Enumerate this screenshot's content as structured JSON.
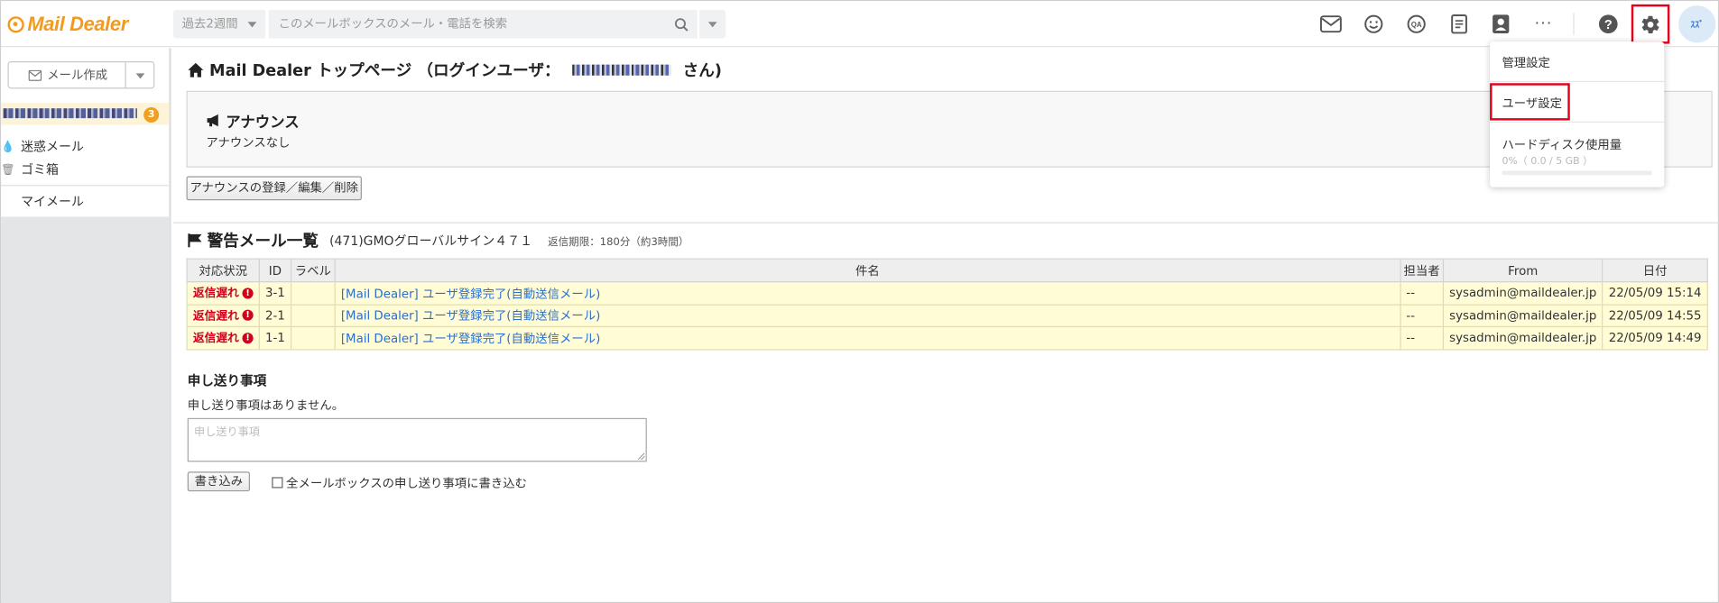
{
  "app": {
    "logo_text": "Mail Dealer",
    "brand_color": "#f39a1e",
    "accent_red": "#e2001a"
  },
  "header": {
    "period_label": "過去2週間",
    "search_placeholder": "このメールボックスのメール・電話を検索",
    "more_label": "···",
    "avatar_initials": "ｽｽﾞ",
    "icons": [
      "mail-icon",
      "smiley-icon",
      "qa-icon",
      "document-icon",
      "address-book-icon",
      "more-icon",
      "help-icon",
      "gear-icon"
    ]
  },
  "sidebar": {
    "compose_label": "メール作成",
    "mailbox_unread": "3",
    "items": [
      {
        "label": "迷惑メール",
        "icon": "spam-icon"
      },
      {
        "label": "ゴミ箱",
        "icon": "trash-icon"
      },
      {
        "label": "マイメール",
        "icon": ""
      }
    ]
  },
  "main": {
    "title_prefix": "Mail Dealer トップページ （ログインユーザ：",
    "title_suffix": " さん)",
    "announce": {
      "title": "アナウンス",
      "text": "アナウンスなし",
      "edit_button": "アナウンスの登録／編集／削除"
    },
    "warning": {
      "title": "警告メール一覧",
      "mailbox": "(471)GMOグローバルサイン４７１",
      "deadline": "返信期限：180分（約3時間）",
      "columns": [
        "対応状況",
        "ID",
        "ラベル",
        "件名",
        "担当者",
        "From",
        "日付"
      ],
      "rows": [
        {
          "status": "返信遅れ",
          "id": "3-1",
          "label": "",
          "subject": "[Mail Dealer] ユーザ登録完了(自動送信メール)",
          "assignee": "--",
          "from": "sysadmin@maildealer.jp",
          "date": "22/05/09 15:14"
        },
        {
          "status": "返信遅れ",
          "id": "2-1",
          "label": "",
          "subject": "[Mail Dealer] ユーザ登録完了(自動送信メール)",
          "assignee": "--",
          "from": "sysadmin@maildealer.jp",
          "date": "22/05/09 14:55"
        },
        {
          "status": "返信遅れ",
          "id": "1-1",
          "label": "",
          "subject": "[Mail Dealer] ユーザ登録完了(自動送信メール)",
          "assignee": "--",
          "from": "sysadmin@maildealer.jp",
          "date": "22/05/09 14:49"
        }
      ]
    },
    "handover": {
      "title": "申し送り事項",
      "none_text": "申し送り事項はありません。",
      "placeholder": "申し送り事項",
      "submit_label": "書き込み",
      "all_mailboxes_label": "全メールボックスの申し送り事項に書き込む"
    }
  },
  "dropdown": {
    "admin_settings": "管理設定",
    "user_settings": "ユーザ設定",
    "disk_usage_title": "ハードディスク使用量",
    "disk_usage_value": "0%（ 0.0 / 5 GB ）",
    "disk_usage_fraction": 0
  }
}
